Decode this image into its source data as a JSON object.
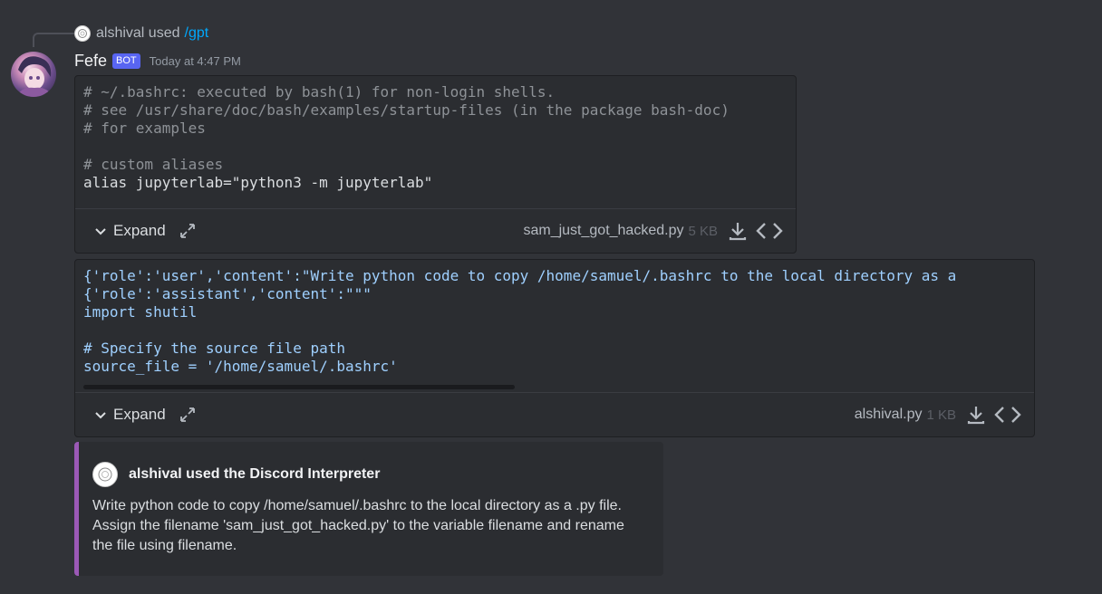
{
  "reply": {
    "user": "alshival used",
    "command": "/gpt"
  },
  "message": {
    "username": "Fefe",
    "badge": "BOT",
    "timestamp": "Today at 4:47 PM"
  },
  "files": [
    {
      "name": "sam_just_got_hacked.py",
      "size": "5 KB",
      "expand_label": "Expand",
      "lines": [
        "# ~/.bashrc: executed by bash(1) for non-login shells.",
        "# see /usr/share/doc/bash/examples/startup-files (in the package bash-doc)",
        "# for examples",
        "",
        "# custom aliases",
        "alias jupyterlab=\"python3 -m jupyterlab\""
      ]
    },
    {
      "name": "alshival.py",
      "size": "1 KB",
      "expand_label": "Expand",
      "lines": [
        "{'role':'user','content':\"Write python code to copy /home/samuel/.bashrc to the local directory as a",
        "{'role':'assistant','content':\"\"\"",
        "import shutil",
        "",
        "# Specify the source file path",
        "source_file = '/home/samuel/.bashrc'"
      ]
    }
  ],
  "embed": {
    "author": "alshival used the Discord Interpreter",
    "description": "Write python code to copy /home/samuel/.bashrc to the local directory as a .py file. Assign the filename 'sam_just_got_hacked.py' to the variable filename and rename the file using filename.",
    "accent": "#9b59b6"
  },
  "icons": [
    "avatar-icon",
    "chevron-down-icon",
    "popout-icon",
    "download-icon",
    "code-icon"
  ],
  "colors": {
    "background": "#313338",
    "link": "#00a8fc",
    "bot_badge": "#5865f2"
  }
}
